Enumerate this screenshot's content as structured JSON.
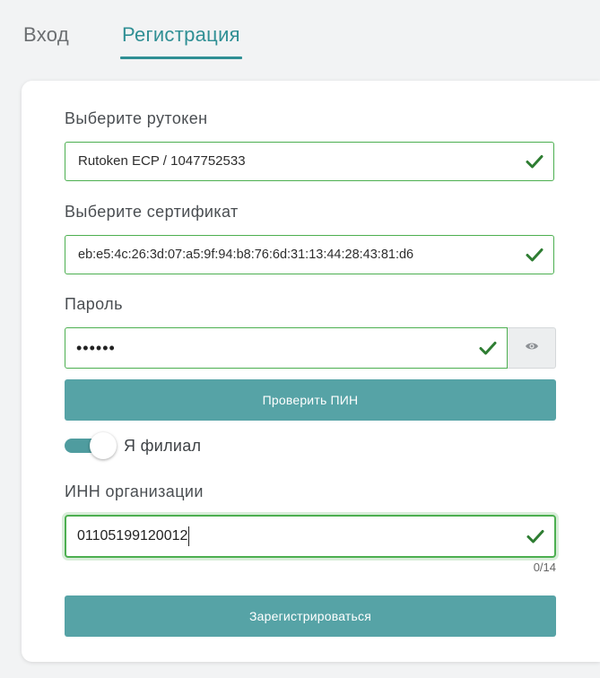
{
  "tabs": {
    "login": "Вход",
    "register": "Регистрация"
  },
  "form": {
    "token_label": "Выберите рутокен",
    "token_value": "Rutoken ECP / 1047752533",
    "cert_label": "Выберите сертификат",
    "cert_value": "eb:e5:4c:26:3d:07:a5:9f:94:b8:76:6d:31:13:44:28:43:81:d6",
    "password_label": "Пароль",
    "password_value": "••••••",
    "check_pin_button": "Проверить ПИН",
    "branch_toggle_label": "Я филиал",
    "branch_toggle_on": true,
    "inn_label": "ИНН организации",
    "inn_value": "01105199120012",
    "inn_counter": "0/14",
    "register_button": "Зарегистрироваться"
  },
  "colors": {
    "accent": "#2f8f94",
    "button": "#56a3a6",
    "valid": "#4caf50",
    "check": "#2e7d32"
  },
  "icons": {
    "valid": "check-icon",
    "toggle_visibility": "eye-icon"
  }
}
